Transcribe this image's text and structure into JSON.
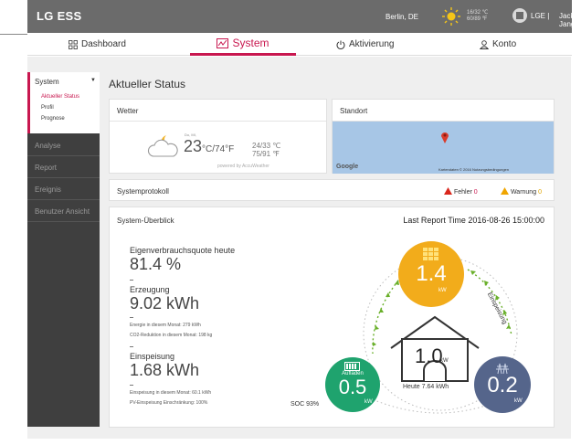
{
  "header": {
    "brand": "LG ESS",
    "location": "Berlin, DE",
    "temps_line1": "16/32 ℃",
    "temps_line2": "60/89 ℉",
    "device": "LGE",
    "user": "Jack Jang",
    "separator": "|"
  },
  "nav": {
    "tabs": [
      {
        "label": "Dashboard",
        "icon": "grid-icon"
      },
      {
        "label": "System",
        "icon": "chart-icon",
        "active": true
      },
      {
        "label": "Aktivierung",
        "icon": "power-icon"
      },
      {
        "label": "Konto",
        "icon": "person-icon"
      }
    ]
  },
  "sidebar": {
    "section": "System",
    "caret": "▼",
    "subitems": [
      "Aktueller Status",
      "Profil",
      "Prognose"
    ],
    "items": [
      "Analyse",
      "Report",
      "Ereignis",
      "Benutzer Ansicht"
    ]
  },
  "page": {
    "title": "Aktueller Status"
  },
  "weather": {
    "title": "Wetter",
    "day": "Do, MI,",
    "temp_c": "23",
    "unit_c": "°C/",
    "temp_f": "74°F",
    "range_c": "24/33 ℃",
    "range_f": "75/91 ℉",
    "powered": "powered by AccuWeather"
  },
  "location_card": {
    "title": "Standort",
    "google": "Google",
    "credit": "Kartendaten © 2016   Nutzungsbedingungen"
  },
  "protokoll": {
    "title": "Systemprotokoll",
    "error_label": "Fehler",
    "error_count": "0",
    "warning_label": "Warnung",
    "warning_count": "0"
  },
  "overview": {
    "title": "System-Überblick",
    "last_report": "Last Report Time 2016-08-26 15:00:00",
    "self_consumption_label": "Eigenverbrauchsquote heute",
    "self_consumption_value": "81.4 %",
    "generation_label": "Erzeugung",
    "generation_value": "9.02 kWh",
    "generation_note1": "Energie in diesem Monat: 279 kWh",
    "generation_note2": "CO2-Reduktion in diesem Monat: 198 kg",
    "feedin_label": "Einspeisung",
    "feedin_value": "1.68 kWh",
    "feedin_note1": "Einspeisung in diesem Monat: 60.1 kWh",
    "feedin_note2": "PV-Einspeisung Einschränkung: 100%",
    "pv_value": "1.4",
    "pv_unit": "kW",
    "home_value": "1.0",
    "home_unit": "kW",
    "home_today": "Heute 7.64 kWh",
    "battery_value": "0.5",
    "battery_unit": "kW",
    "battery_status": "Aufladen",
    "soc": "SOC 93%",
    "grid_value": "0.2",
    "grid_unit": "kW",
    "feedin_arc_label": "Einspeisung",
    "colors": {
      "pv": "#f2ac1b",
      "battery": "#1fa36e",
      "grid": "#55658b",
      "accent": "#c8174f",
      "arrow": "#6ab02b"
    }
  }
}
